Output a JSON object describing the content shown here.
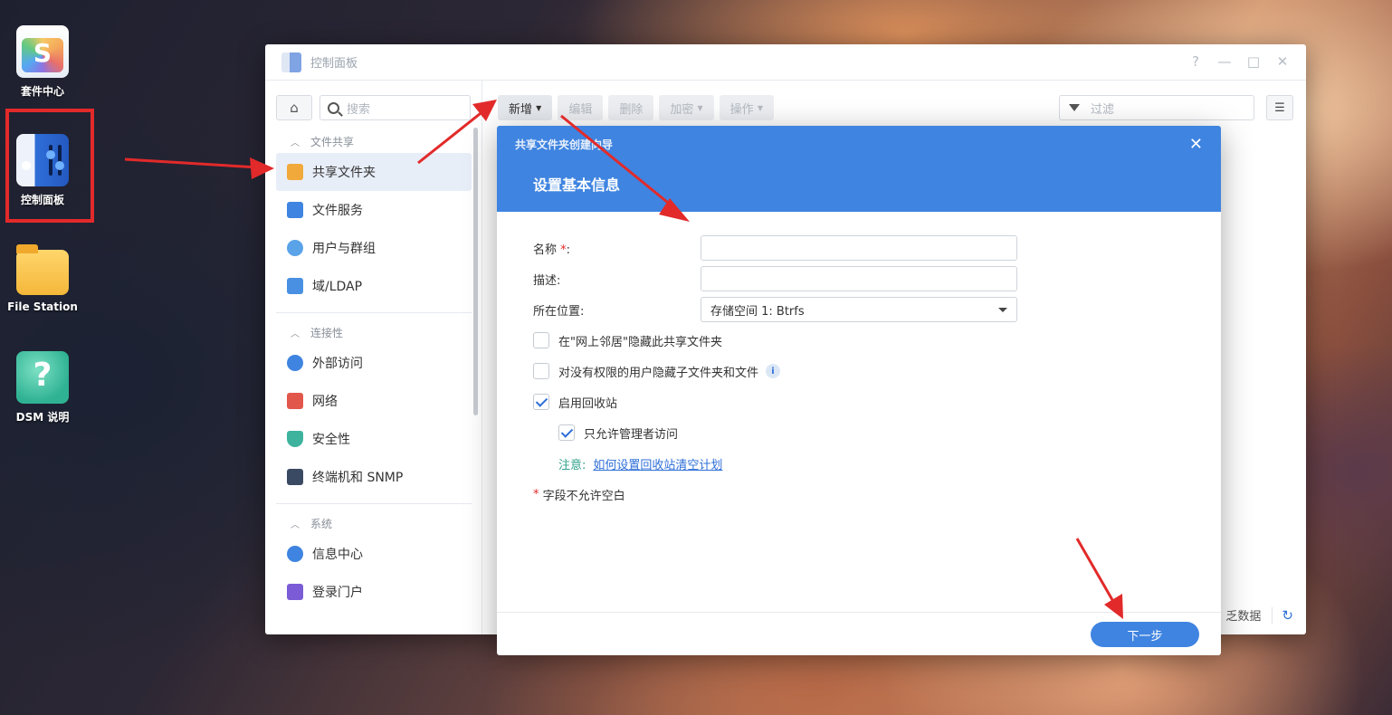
{
  "desktop": {
    "icons": [
      {
        "label": "套件中心"
      },
      {
        "label": "控制面板"
      },
      {
        "label": "File Station"
      },
      {
        "label": "DSM 说明"
      }
    ]
  },
  "window": {
    "title": "控制面板",
    "controls": {
      "help": "?",
      "minimize": "—",
      "maximize": "□",
      "close": "✕"
    },
    "search_placeholder": "搜索",
    "sidebar": {
      "sections": [
        {
          "title": "文件共享",
          "items": [
            "共享文件夹",
            "文件服务",
            "用户与群组",
            "域/LDAP"
          ]
        },
        {
          "title": "连接性",
          "items": [
            "外部访问",
            "网络",
            "安全性",
            "终端机和 SNMP"
          ]
        },
        {
          "title": "系统",
          "items": [
            "信息中心",
            "登录门户"
          ]
        }
      ]
    },
    "toolbar": {
      "create": "新增",
      "edit": "编辑",
      "delete": "删除",
      "encrypt": "加密",
      "action": "操作"
    },
    "filter_placeholder": "过滤",
    "bottom_text": "乏数据"
  },
  "dialog": {
    "wizard_title": "共享文件夹创建向导",
    "step_title": "设置基本信息",
    "close": "✕",
    "fields": {
      "name_label": "名称",
      "name_required": "*",
      "name_colon": ":",
      "name_value": "",
      "desc_label": "描述:",
      "desc_value": "",
      "location_label": "所在位置:",
      "location_value": "存储空间 1:  Btrfs"
    },
    "checkboxes": {
      "hide_network": {
        "label": "在\"网上邻居\"隐藏此共享文件夹",
        "checked": false
      },
      "hide_subfolders": {
        "label": "对没有权限的用户隐藏子文件夹和文件",
        "checked": false
      },
      "recycle_bin": {
        "label": "启用回收站",
        "checked": true
      },
      "admin_only": {
        "label": "只允许管理者访问",
        "checked": true
      }
    },
    "note_label": "注意:",
    "note_link": "如何设置回收站清空计划",
    "required_mark": "*",
    "required_note": "字段不允许空白",
    "next_button": "下一步"
  },
  "colors": {
    "accent": "#3f84e0",
    "annotation_red": "#e22a2a"
  }
}
